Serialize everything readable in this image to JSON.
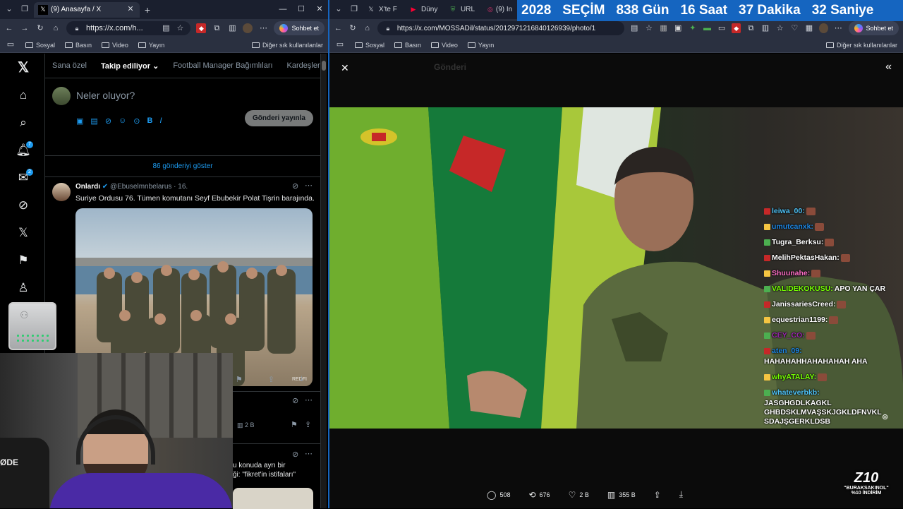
{
  "left_browser": {
    "tabs": [
      {
        "label": "(9) Anasayfa / X",
        "icon": "x-logo-icon"
      }
    ],
    "url": "https://x.com/h...",
    "copilot_label": "Sohbet et",
    "bookmarks": [
      "Sosyal",
      "Basın",
      "Video",
      "Yayın"
    ],
    "other_bookmarks": "Diğer sık kullanılanlar"
  },
  "right_browser": {
    "tabs": [
      {
        "label": "X'te F",
        "icon": "x-logo-icon"
      },
      {
        "label": "Düny",
        "icon": "youtube-icon"
      },
      {
        "label": "URL",
        "icon": "shield-icon"
      },
      {
        "label": "(9) In",
        "icon": "instagram-icon"
      }
    ],
    "url": "https://x.com/MOSSADil/status/2012971216840126939/photo/1",
    "copilot_label": "Sohbet et",
    "bookmarks": [
      "Sosyal",
      "Basın",
      "Video",
      "Yayın"
    ],
    "other_bookmarks": "Diğer sık kullanılanlar"
  },
  "countdown": {
    "year": "2028",
    "label": "SEÇİM",
    "days": "838 Gün",
    "hours": "16 Saat",
    "minutes": "37 Dakika",
    "seconds": "32 Saniye"
  },
  "x_feed": {
    "tabs": [
      "Sana özel",
      "Takip ediliyor",
      "Football Manager Bağımlıları",
      "Kardeşler Kr"
    ],
    "active_tab": 1,
    "composer_placeholder": "Neler oluyor?",
    "post_button": "Gönderi yayınla",
    "show_more": "86 gönderiyi göster",
    "nav_badges": {
      "notifications": "7",
      "messages": "2"
    },
    "post": {
      "name": "Onlardı",
      "handle": "@Ebuselmnbelarus",
      "time": "16.",
      "text": "Suriye Ordusu 76. Tümen komutanı Seyf Ebubekir Polat Tişrin barajında.",
      "image_watermark": "REDFI"
    },
    "second_post": {
      "views": "2 B"
    },
    "third_post": {
      "text": "u konuda ayrı bir",
      "text2": "ği: \"fikret'in istifaları\""
    }
  },
  "viewer": {
    "back_text": "Gönderi",
    "actions": [
      {
        "icon": "reply-icon",
        "count": "508"
      },
      {
        "icon": "repost-icon",
        "count": "676"
      },
      {
        "icon": "like-icon",
        "count": "2 B"
      },
      {
        "icon": "views-icon",
        "count": "355 B"
      }
    ]
  },
  "chat": [
    {
      "user": "leiwa_00:",
      "color": "#4fc3f7",
      "msg": ""
    },
    {
      "user": "umutcanxk:",
      "color": "#1e88e5",
      "msg": ""
    },
    {
      "user": "Tugra_Berksu:",
      "color": "#ffffff",
      "msg": ""
    },
    {
      "user": "MelihPektasHakan:",
      "color": "#ffffff",
      "msg": ""
    },
    {
      "user": "Shuunahe:",
      "color": "#ff6ec7",
      "msg": ""
    },
    {
      "user": "VALIDEKOKUSU:",
      "color": "#76ff03",
      "msg": "APO YAN ÇAR"
    },
    {
      "user": "JanissariesCreed:",
      "color": "#ffffff",
      "msg": ""
    },
    {
      "user": "equestrian1199:",
      "color": "#ffffff",
      "msg": ""
    },
    {
      "user": "CEY_CO:",
      "color": "#9c27b0",
      "msg": ""
    },
    {
      "user": "aten_09:",
      "color": "#1e88e5",
      "msg": "HAHAHAHHAHAHAHAH AHA"
    },
    {
      "user": "whyATALAY:",
      "color": "#76ff03",
      "msg": ""
    },
    {
      "user": "whateverbkb:",
      "color": "#4fc3f7",
      "msg": "JASGHGDLKAGKL GHBDSKLMVAŞSKJGKLDFNVKL SDAJŞGERKLDSB"
    }
  ],
  "watermark": {
    "brand": "Z10",
    "line1": "\"BURAKSAKINOL\"",
    "line2": "%10 İNDİRİM"
  },
  "webcam_chair_text": "ØDE"
}
